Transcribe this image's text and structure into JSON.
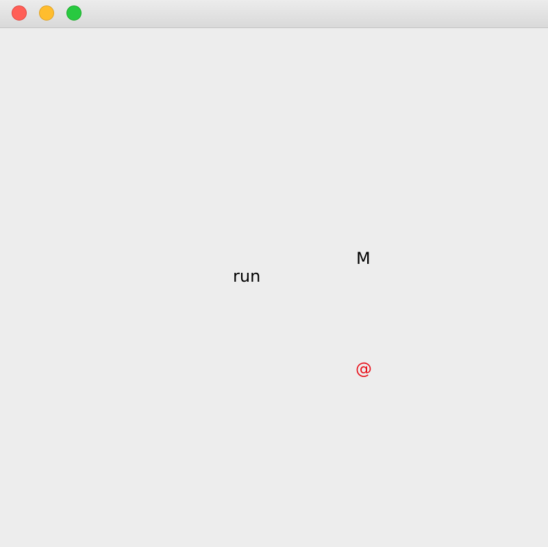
{
  "window": {
    "traffic_lights": [
      {
        "name": "close",
        "color": "#ff5f57"
      },
      {
        "name": "minimize",
        "color": "#ffbd2e"
      },
      {
        "name": "zoom",
        "color": "#28c940"
      }
    ]
  },
  "canvas": {
    "labels": {
      "m": "M",
      "run": "run",
      "at": "@"
    },
    "colors": {
      "default_text": "#000000",
      "at_symbol": "#e8101a",
      "background": "#ededed"
    }
  }
}
